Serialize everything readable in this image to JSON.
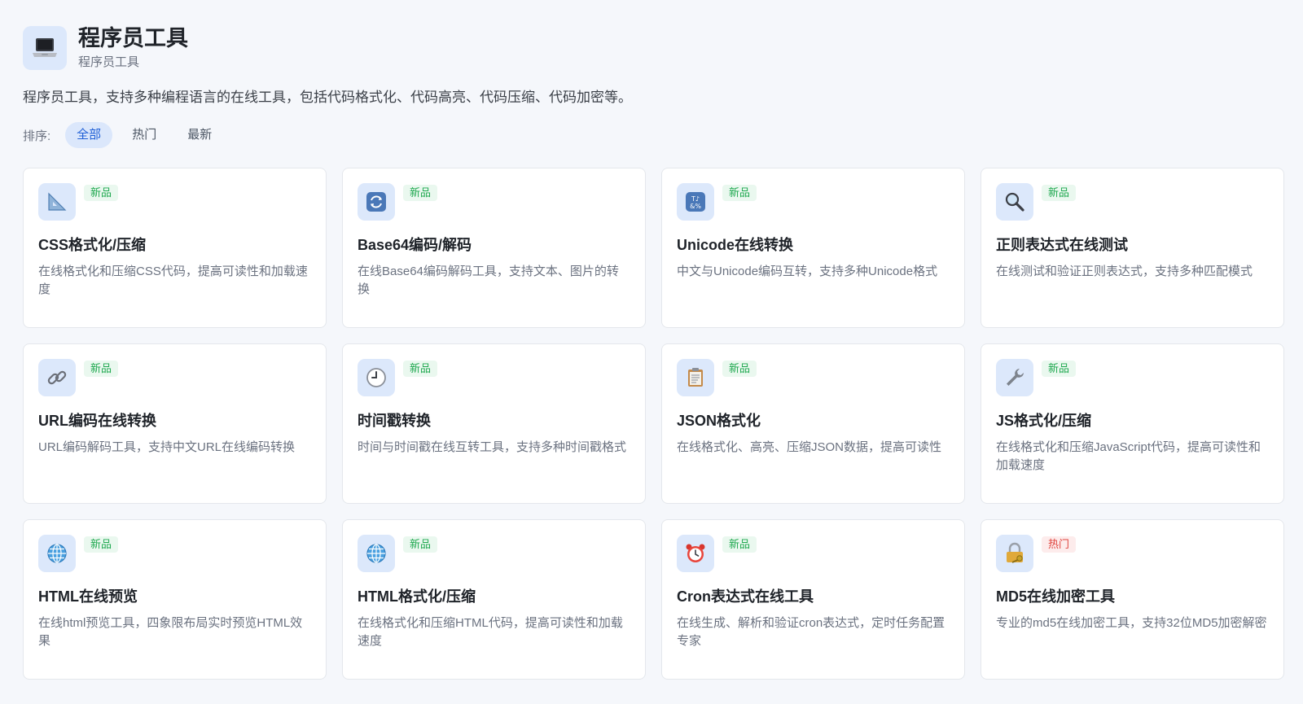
{
  "header": {
    "icon": "laptop-icon",
    "title": "程序员工具",
    "subtitle": "程序员工具"
  },
  "description": "程序员工具，支持多种编程语言的在线工具，包括代码格式化、代码高亮、代码压缩、代码加密等。",
  "sort": {
    "label": "排序:",
    "tabs": [
      {
        "label": "全部",
        "active": true
      },
      {
        "label": "热门",
        "active": false
      },
      {
        "label": "最新",
        "active": false
      }
    ]
  },
  "tools": [
    {
      "icon": "triangle-ruler-icon",
      "badge": "新品",
      "badge_type": "new",
      "title": "CSS格式化/压缩",
      "desc": "在线格式化和压缩CSS代码，提高可读性和加载速度"
    },
    {
      "icon": "refresh-icon",
      "badge": "新品",
      "badge_type": "new",
      "title": "Base64编码/解码",
      "desc": "在线Base64编码解码工具，支持文本、图片的转换"
    },
    {
      "icon": "symbols-icon",
      "badge": "新品",
      "badge_type": "new",
      "title": "Unicode在线转换",
      "desc": "中文与Unicode编码互转，支持多种Unicode格式"
    },
    {
      "icon": "magnifier-icon",
      "badge": "新品",
      "badge_type": "new",
      "title": "正则表达式在线测试",
      "desc": "在线测试和验证正则表达式，支持多种匹配模式"
    },
    {
      "icon": "link-icon",
      "badge": "新品",
      "badge_type": "new",
      "title": "URL编码在线转换",
      "desc": "URL编码解码工具，支持中文URL在线编码转换"
    },
    {
      "icon": "clock-icon",
      "badge": "新品",
      "badge_type": "new",
      "title": "时间戳转换",
      "desc": "时间与时间戳在线互转工具，支持多种时间戳格式"
    },
    {
      "icon": "clipboard-icon",
      "badge": "新品",
      "badge_type": "new",
      "title": "JSON格式化",
      "desc": "在线格式化、高亮、压缩JSON数据，提高可读性"
    },
    {
      "icon": "wrench-icon",
      "badge": "新品",
      "badge_type": "new",
      "title": "JS格式化/压缩",
      "desc": "在线格式化和压缩JavaScript代码，提高可读性和加载速度"
    },
    {
      "icon": "globe-icon",
      "badge": "新品",
      "badge_type": "new",
      "title": "HTML在线预览",
      "desc": "在线html预览工具，四象限布局实时预览HTML效果"
    },
    {
      "icon": "globe-icon",
      "badge": "新品",
      "badge_type": "new",
      "title": "HTML格式化/压缩",
      "desc": "在线格式化和压缩HTML代码，提高可读性和加载速度"
    },
    {
      "icon": "alarm-clock-icon",
      "badge": "新品",
      "badge_type": "new",
      "title": "Cron表达式在线工具",
      "desc": "在线生成、解析和验证cron表达式，定时任务配置专家"
    },
    {
      "icon": "padlock-key-icon",
      "badge": "热门",
      "badge_type": "hot",
      "title": "MD5在线加密工具",
      "desc": "专业的md5在线加密工具，支持32位MD5加密解密"
    }
  ],
  "colors": {
    "accent": "#1f5fd6",
    "new_badge": "#1fa84f",
    "hot_badge": "#e0443e",
    "icon_bg": "#dce8fb"
  }
}
